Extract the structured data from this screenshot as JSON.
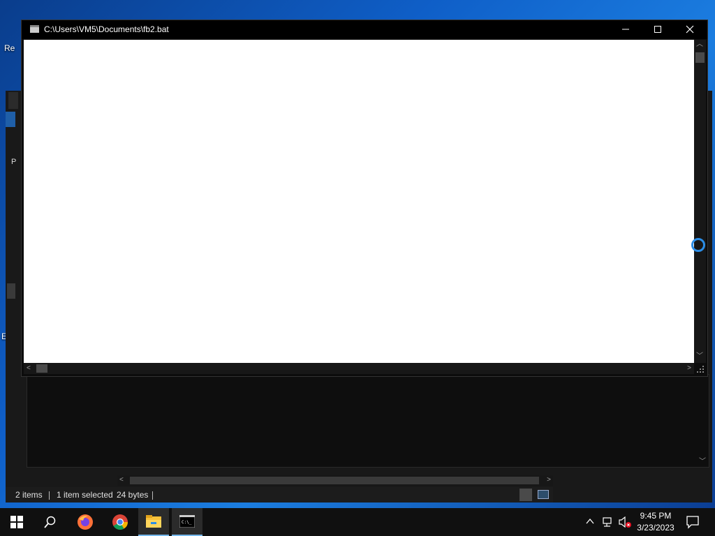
{
  "desktop": {
    "icon_label_1": "Re",
    "icon_label_2": "E"
  },
  "console": {
    "title": "C:\\Users\\VM5\\Documents\\fb2.bat",
    "minimize_label": "—",
    "maximize_label": "☐",
    "close_label": "✕"
  },
  "explorer": {
    "side_letter_1": "P",
    "status_items": "2 items",
    "status_selected": "1 item selected",
    "status_size": "24 bytes"
  },
  "taskbar": {
    "apps": [
      "start-icon",
      "search-icon",
      "firefox-icon",
      "chrome-icon",
      "file-explorer-icon",
      "cmd-icon"
    ],
    "time": "9:45 PM",
    "date": "3/23/2023"
  }
}
